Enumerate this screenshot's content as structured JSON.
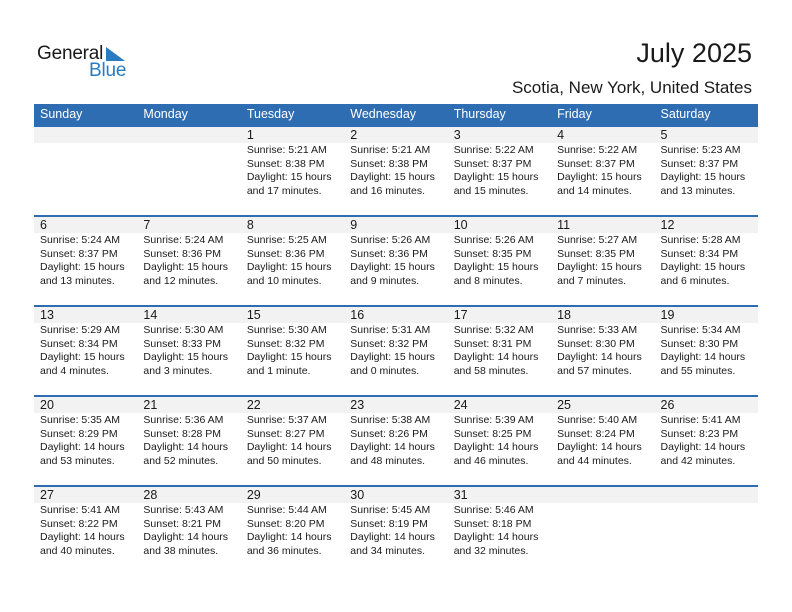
{
  "logo": {
    "general": "General",
    "blue": "Blue",
    "icon": "triangle-flag-icon",
    "brand_color": "#2a7bbf"
  },
  "header": {
    "title": "July 2025",
    "subtitle": "Scotia, New York, United States"
  },
  "colors": {
    "accent": "#2e6db2",
    "band": "#f2f2f2"
  },
  "weekdays": [
    "Sunday",
    "Monday",
    "Tuesday",
    "Wednesday",
    "Thursday",
    "Friday",
    "Saturday"
  ],
  "weeks": [
    [
      null,
      null,
      {
        "day": "1",
        "sunrise": "Sunrise: 5:21 AM",
        "sunset": "Sunset: 8:38 PM",
        "daylight1": "Daylight: 15 hours",
        "daylight2": "and 17 minutes."
      },
      {
        "day": "2",
        "sunrise": "Sunrise: 5:21 AM",
        "sunset": "Sunset: 8:38 PM",
        "daylight1": "Daylight: 15 hours",
        "daylight2": "and 16 minutes."
      },
      {
        "day": "3",
        "sunrise": "Sunrise: 5:22 AM",
        "sunset": "Sunset: 8:37 PM",
        "daylight1": "Daylight: 15 hours",
        "daylight2": "and 15 minutes."
      },
      {
        "day": "4",
        "sunrise": "Sunrise: 5:22 AM",
        "sunset": "Sunset: 8:37 PM",
        "daylight1": "Daylight: 15 hours",
        "daylight2": "and 14 minutes."
      },
      {
        "day": "5",
        "sunrise": "Sunrise: 5:23 AM",
        "sunset": "Sunset: 8:37 PM",
        "daylight1": "Daylight: 15 hours",
        "daylight2": "and 13 minutes."
      }
    ],
    [
      {
        "day": "6",
        "sunrise": "Sunrise: 5:24 AM",
        "sunset": "Sunset: 8:37 PM",
        "daylight1": "Daylight: 15 hours",
        "daylight2": "and 13 minutes."
      },
      {
        "day": "7",
        "sunrise": "Sunrise: 5:24 AM",
        "sunset": "Sunset: 8:36 PM",
        "daylight1": "Daylight: 15 hours",
        "daylight2": "and 12 minutes."
      },
      {
        "day": "8",
        "sunrise": "Sunrise: 5:25 AM",
        "sunset": "Sunset: 8:36 PM",
        "daylight1": "Daylight: 15 hours",
        "daylight2": "and 10 minutes."
      },
      {
        "day": "9",
        "sunrise": "Sunrise: 5:26 AM",
        "sunset": "Sunset: 8:36 PM",
        "daylight1": "Daylight: 15 hours",
        "daylight2": "and 9 minutes."
      },
      {
        "day": "10",
        "sunrise": "Sunrise: 5:26 AM",
        "sunset": "Sunset: 8:35 PM",
        "daylight1": "Daylight: 15 hours",
        "daylight2": "and 8 minutes."
      },
      {
        "day": "11",
        "sunrise": "Sunrise: 5:27 AM",
        "sunset": "Sunset: 8:35 PM",
        "daylight1": "Daylight: 15 hours",
        "daylight2": "and 7 minutes."
      },
      {
        "day": "12",
        "sunrise": "Sunrise: 5:28 AM",
        "sunset": "Sunset: 8:34 PM",
        "daylight1": "Daylight: 15 hours",
        "daylight2": "and 6 minutes."
      }
    ],
    [
      {
        "day": "13",
        "sunrise": "Sunrise: 5:29 AM",
        "sunset": "Sunset: 8:34 PM",
        "daylight1": "Daylight: 15 hours",
        "daylight2": "and 4 minutes."
      },
      {
        "day": "14",
        "sunrise": "Sunrise: 5:30 AM",
        "sunset": "Sunset: 8:33 PM",
        "daylight1": "Daylight: 15 hours",
        "daylight2": "and 3 minutes."
      },
      {
        "day": "15",
        "sunrise": "Sunrise: 5:30 AM",
        "sunset": "Sunset: 8:32 PM",
        "daylight1": "Daylight: 15 hours",
        "daylight2": "and 1 minute."
      },
      {
        "day": "16",
        "sunrise": "Sunrise: 5:31 AM",
        "sunset": "Sunset: 8:32 PM",
        "daylight1": "Daylight: 15 hours",
        "daylight2": "and 0 minutes."
      },
      {
        "day": "17",
        "sunrise": "Sunrise: 5:32 AM",
        "sunset": "Sunset: 8:31 PM",
        "daylight1": "Daylight: 14 hours",
        "daylight2": "and 58 minutes."
      },
      {
        "day": "18",
        "sunrise": "Sunrise: 5:33 AM",
        "sunset": "Sunset: 8:30 PM",
        "daylight1": "Daylight: 14 hours",
        "daylight2": "and 57 minutes."
      },
      {
        "day": "19",
        "sunrise": "Sunrise: 5:34 AM",
        "sunset": "Sunset: 8:30 PM",
        "daylight1": "Daylight: 14 hours",
        "daylight2": "and 55 minutes."
      }
    ],
    [
      {
        "day": "20",
        "sunrise": "Sunrise: 5:35 AM",
        "sunset": "Sunset: 8:29 PM",
        "daylight1": "Daylight: 14 hours",
        "daylight2": "and 53 minutes."
      },
      {
        "day": "21",
        "sunrise": "Sunrise: 5:36 AM",
        "sunset": "Sunset: 8:28 PM",
        "daylight1": "Daylight: 14 hours",
        "daylight2": "and 52 minutes."
      },
      {
        "day": "22",
        "sunrise": "Sunrise: 5:37 AM",
        "sunset": "Sunset: 8:27 PM",
        "daylight1": "Daylight: 14 hours",
        "daylight2": "and 50 minutes."
      },
      {
        "day": "23",
        "sunrise": "Sunrise: 5:38 AM",
        "sunset": "Sunset: 8:26 PM",
        "daylight1": "Daylight: 14 hours",
        "daylight2": "and 48 minutes."
      },
      {
        "day": "24",
        "sunrise": "Sunrise: 5:39 AM",
        "sunset": "Sunset: 8:25 PM",
        "daylight1": "Daylight: 14 hours",
        "daylight2": "and 46 minutes."
      },
      {
        "day": "25",
        "sunrise": "Sunrise: 5:40 AM",
        "sunset": "Sunset: 8:24 PM",
        "daylight1": "Daylight: 14 hours",
        "daylight2": "and 44 minutes."
      },
      {
        "day": "26",
        "sunrise": "Sunrise: 5:41 AM",
        "sunset": "Sunset: 8:23 PM",
        "daylight1": "Daylight: 14 hours",
        "daylight2": "and 42 minutes."
      }
    ],
    [
      {
        "day": "27",
        "sunrise": "Sunrise: 5:41 AM",
        "sunset": "Sunset: 8:22 PM",
        "daylight1": "Daylight: 14 hours",
        "daylight2": "and 40 minutes."
      },
      {
        "day": "28",
        "sunrise": "Sunrise: 5:43 AM",
        "sunset": "Sunset: 8:21 PM",
        "daylight1": "Daylight: 14 hours",
        "daylight2": "and 38 minutes."
      },
      {
        "day": "29",
        "sunrise": "Sunrise: 5:44 AM",
        "sunset": "Sunset: 8:20 PM",
        "daylight1": "Daylight: 14 hours",
        "daylight2": "and 36 minutes."
      },
      {
        "day": "30",
        "sunrise": "Sunrise: 5:45 AM",
        "sunset": "Sunset: 8:19 PM",
        "daylight1": "Daylight: 14 hours",
        "daylight2": "and 34 minutes."
      },
      {
        "day": "31",
        "sunrise": "Sunrise: 5:46 AM",
        "sunset": "Sunset: 8:18 PM",
        "daylight1": "Daylight: 14 hours",
        "daylight2": "and 32 minutes."
      },
      null,
      null
    ]
  ]
}
